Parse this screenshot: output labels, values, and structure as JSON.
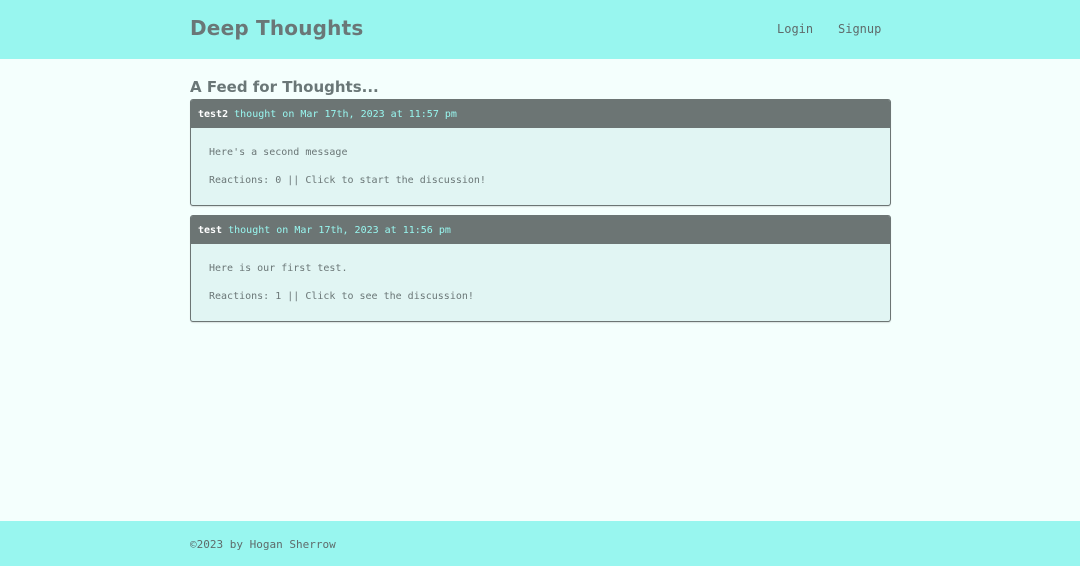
{
  "header": {
    "brand": "Deep Thoughts",
    "nav": {
      "login": "Login",
      "signup": "Signup"
    }
  },
  "main": {
    "title": "A Feed for Thoughts...",
    "thoughts": [
      {
        "username": "test2",
        "stamp": "thought on Mar 17th, 2023 at 11:57 pm",
        "text": "Here's a second message",
        "reactions": "Reactions: 0 || Click to start the discussion!"
      },
      {
        "username": "test",
        "stamp": "thought on Mar 17th, 2023 at 11:56 pm",
        "text": "Here is our first test.",
        "reactions": "Reactions: 1 || Click to see the discussion!"
      }
    ]
  },
  "footer": {
    "copyright": "©2023 by Hogan Sherrow"
  },
  "colors": {
    "accent": "#98f6ef",
    "header_bar": "#6c7574",
    "text": "#6a7777",
    "card_bg": "#e1f5f3",
    "page_bg": "#f4fffd"
  }
}
